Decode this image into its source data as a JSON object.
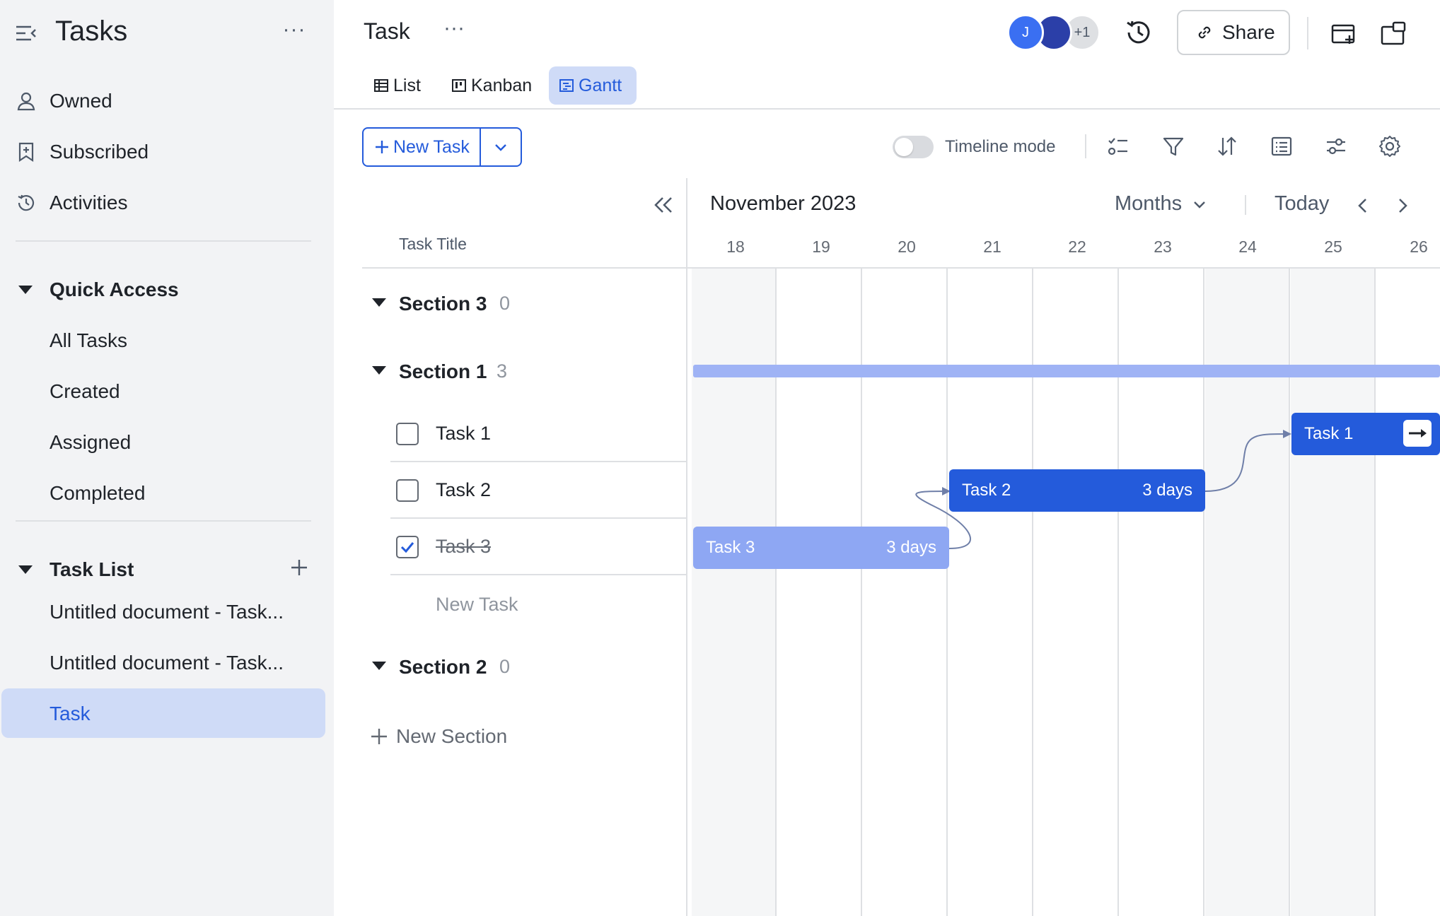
{
  "sidebar": {
    "title": "Tasks",
    "more": "···",
    "nav": [
      {
        "label": "Owned",
        "icon": "person-icon"
      },
      {
        "label": "Subscribed",
        "icon": "bookmark-icon"
      },
      {
        "label": "Activities",
        "icon": "history-icon"
      }
    ],
    "quick_access": {
      "label": "Quick Access",
      "items": [
        "All Tasks",
        "Created",
        "Assigned",
        "Completed"
      ]
    },
    "task_list": {
      "label": "Task List",
      "items": [
        "Untitled document - Task...",
        "Untitled document - Task...",
        "Task"
      ],
      "active": "Task"
    }
  },
  "header": {
    "title": "Task",
    "more": "···",
    "avatars": [
      "J",
      "",
      "+1"
    ],
    "share_label": "Share"
  },
  "tabs": [
    {
      "label": "List",
      "active": false
    },
    {
      "label": "Kanban",
      "active": false
    },
    {
      "label": "Gantt",
      "active": true
    }
  ],
  "toolbar": {
    "new_task_label": "New Task",
    "timeline_mode_label": "Timeline mode",
    "timeline_mode_on": false
  },
  "task_panel": {
    "column_title": "Task Title",
    "sections": [
      {
        "name": "Section 3",
        "count": "0"
      },
      {
        "name": "Section 1",
        "count": "3"
      },
      {
        "name": "Section 2",
        "count": "0"
      }
    ],
    "tasks": [
      {
        "title": "Task 1",
        "done": false
      },
      {
        "title": "Task 2",
        "done": false
      },
      {
        "title": "Task 3",
        "done": true
      }
    ],
    "new_task_placeholder": "New Task",
    "new_section_label": "New Section"
  },
  "gantt": {
    "month_label": "November 2023",
    "scale_label": "Months",
    "today_label": "Today",
    "days": [
      "18",
      "19",
      "20",
      "21",
      "22",
      "23",
      "24",
      "25",
      "26"
    ],
    "bars": [
      {
        "task": "Task 1",
        "start": "25",
        "duration_label": ""
      },
      {
        "task": "Task 2",
        "start": "21",
        "duration_label": "3 days"
      },
      {
        "task": "Task 3",
        "start": "18",
        "duration_label": "3 days"
      }
    ],
    "colors": {
      "accent": "#245bdb",
      "done_bar": "#8ea7f3",
      "section_bar": "#9fb3f5"
    }
  }
}
